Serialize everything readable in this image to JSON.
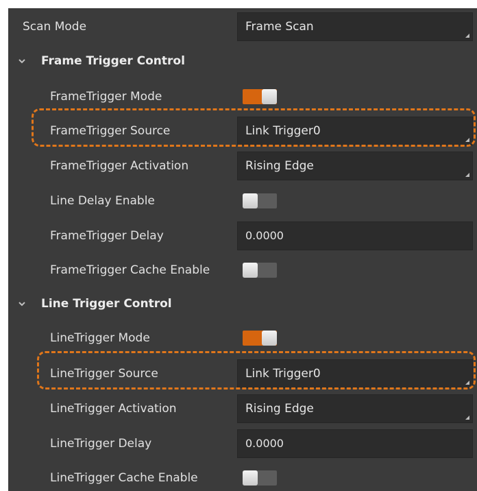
{
  "scan_mode": {
    "label": "Scan Mode",
    "value": "Frame Scan"
  },
  "frame_trigger_control": {
    "title": "Frame Trigger Control",
    "mode": {
      "label": "FrameTrigger Mode",
      "state": "on"
    },
    "source": {
      "label": "FrameTrigger Source",
      "value": "Link Trigger0"
    },
    "activation": {
      "label": "FrameTrigger Activation",
      "value": "Rising Edge"
    },
    "line_delay_enable": {
      "label": "Line Delay Enable",
      "state": "off"
    },
    "delay": {
      "label": "FrameTrigger Delay",
      "value": "0.0000"
    },
    "cache_enable": {
      "label": "FrameTrigger Cache Enable",
      "state": "off"
    }
  },
  "line_trigger_control": {
    "title": "Line Trigger Control",
    "mode": {
      "label": "LineTrigger Mode",
      "state": "on"
    },
    "source": {
      "label": "LineTrigger Source",
      "value": "Link Trigger0"
    },
    "activation": {
      "label": "LineTrigger Activation",
      "value": "Rising Edge"
    },
    "delay": {
      "label": "LineTrigger Delay",
      "value": "0.0000"
    },
    "cache_enable": {
      "label": "LineTrigger Cache Enable",
      "state": "off"
    }
  },
  "colors": {
    "panel_bg": "#3b3b3b",
    "field_bg": "#2c2c2c",
    "toggle_on": "#d6650f",
    "highlight_dash": "#e0761a"
  },
  "icons": {
    "section_toggle": "chevron-down-icon",
    "dropdown_corner": "dropdown-corner-icon"
  }
}
